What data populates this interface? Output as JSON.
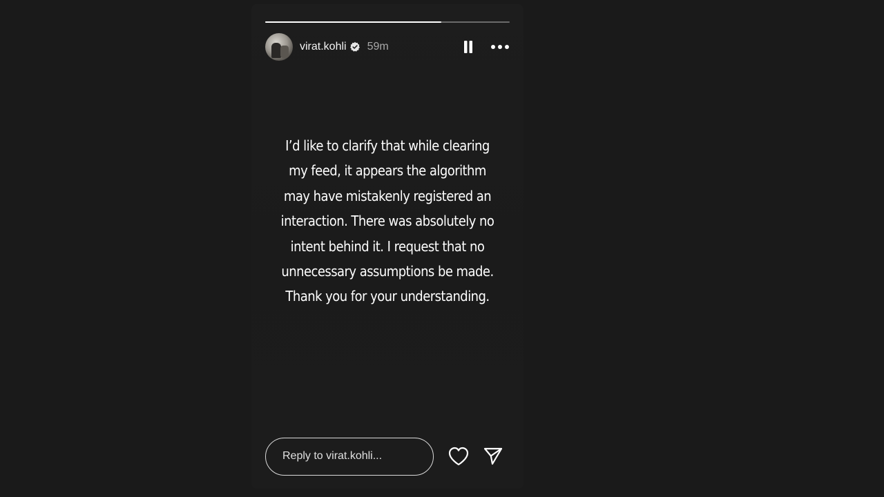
{
  "story": {
    "progress_fraction": 0.72,
    "user": {
      "username": "virat.kohli",
      "verified": true,
      "time_ago": "59m"
    },
    "text": "I’d like to clarify that while clearing my feed, it appears the algorithm may have mistakenly registered an interaction. There was absolutely no intent behind it. I request that no unnecessary assumptions be made. Thank you for your understanding.",
    "reply": {
      "placeholder": "Reply to virat.kohli..."
    },
    "icons": {
      "pause": "pause-icon",
      "more": "more-horizontal-icon",
      "verified": "verified-badge-icon",
      "like": "heart-icon",
      "share": "send-icon"
    },
    "colors": {
      "background": "#1a1a1a",
      "card": "#1c1c1c",
      "text": "#ffffff",
      "muted": "#a8a8a8"
    }
  }
}
